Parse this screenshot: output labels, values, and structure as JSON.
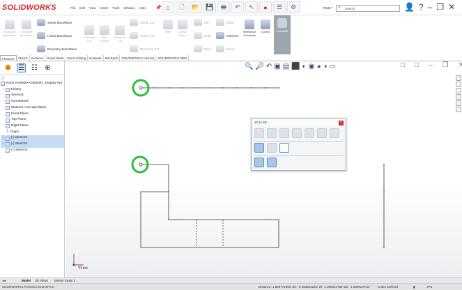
{
  "app": {
    "logo": "SOLIDWORKS",
    "doc_name": "Part2 *"
  },
  "menu": [
    "File",
    "Edit",
    "View",
    "Insert",
    "Tools",
    "Window",
    "Help"
  ],
  "search": {
    "placeholder": "Search",
    "value": "Search"
  },
  "ribbon": {
    "extruded_boss": "Extruded\nBoss/Base",
    "revolved_boss": "Revolved\nBoss/Base",
    "swept_boss": "Swept Boss/Base",
    "lofted_boss": "Lofted Boss/Base",
    "boundary_boss": "Boundary Boss/Base",
    "extruded_cut": "Extruded\nCut",
    "hole_wizard": "Hole\nWizard",
    "revolved_cut": "Revolved\nCut",
    "swept_cut": "Swept Cut",
    "lofted_cut": "Lofted Cut",
    "boundary_cut": "Boundary Cut",
    "fillet": "Fillet",
    "linear_pattern": "Linear\nPattern",
    "rib": "Rib",
    "draft": "Draft",
    "shell": "Shell",
    "wrap": "Wrap",
    "intersect": "Intersect",
    "mirror": "Mirror",
    "reference_geometry": "Reference\nGeometry",
    "curves": "Curves",
    "instant3d": "Instant3D"
  },
  "tabs": [
    "Features",
    "Sketch",
    "Surfaces",
    "Sheet Metal",
    "Direct Editing",
    "Evaluate",
    "DimXpert",
    "SOLIDWORKS Add-Ins",
    "SOLIDWORKS MBD"
  ],
  "active_tab": "Features",
  "tree": {
    "root": "Part2 (Default<<Default>_Display Sta",
    "items": [
      "History",
      "Sensors",
      "Annotations",
      "Material <not specified>",
      "Front Plane",
      "Top Plane",
      "Right Plane",
      "Origin",
      "(-) Sketch2",
      "(-) Sketch3",
      "(-) Sketch4"
    ]
  },
  "dialog": {
    "title": "2D to 3D",
    "close": "×"
  },
  "view_label": "*Front",
  "bottom_tabs": [
    "Model",
    "3D Views",
    "Motion Study 1"
  ],
  "status": {
    "app_version": "SOLIDWORKS Premium 2018 SP4.0",
    "distance": "Distance: 1.85977259in  dX: -0.46382325in  dY: 1.08002475in  dZ: -1.58802475in",
    "state": "Under Defined",
    "units": "IPS"
  },
  "colors": {
    "brand_red": "#d8262e",
    "highlight_green": "#2ebd3a",
    "selection_blue": "#c6dcf5"
  }
}
